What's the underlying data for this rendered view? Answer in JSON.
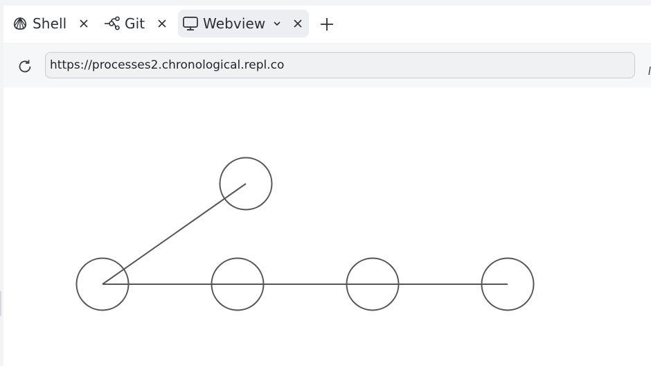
{
  "tabs": [
    {
      "label": "Shell",
      "icon": "shell-icon",
      "active": false
    },
    {
      "label": "Git",
      "icon": "git-branch-icon",
      "active": false
    },
    {
      "label": "Webview",
      "icon": "monitor-icon",
      "active": true
    }
  ],
  "toolbar": {
    "url": "https://processes2.chronological.repl.co"
  },
  "webview": {
    "graph": {
      "nodes": [
        "n1",
        "n2",
        "n3",
        "n4",
        "n5"
      ],
      "edges": [
        [
          "n1",
          "n2"
        ],
        [
          "n1",
          "n3"
        ],
        [
          "n3",
          "n4"
        ],
        [
          "n4",
          "n5"
        ]
      ]
    }
  },
  "colors": {
    "accent": "#2b2f36",
    "active_tab_bg": "#eceef1",
    "stroke": "#555555"
  }
}
